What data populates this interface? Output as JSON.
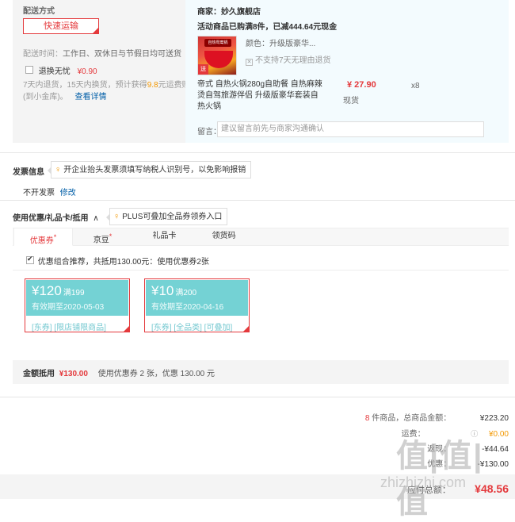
{
  "shipping": {
    "title": "配送方式",
    "method": "快速运输",
    "time_label": "配送时间：",
    "time_value": "工作日、双休日与节假日均可送货",
    "return_label": "退换无忧",
    "return_price": "¥0.90",
    "return_desc_1": "7天内退货，15天内换货，预计获得",
    "return_bonus": "9.8",
    "return_desc_2": "元运费赔付",
    "return_desc_3": "(到小金库)。",
    "details_link": "查看详情"
  },
  "shop": {
    "seller_label": "商家：",
    "seller_name": "妙久旗舰店",
    "promo_1": "活动商品已购满8件，已减444.64元现金",
    "color_label": "颜色：",
    "color_value": "升级版豪华...",
    "no_return_notice": "不支持7天无理由退货",
    "product_name": "帝式 自热火锅280g自助餐 自热麻辣烫自驾旅游伴侣 升级版豪华套装自热火锅",
    "price": "¥ 27.90",
    "quantity": "x8",
    "stock": "现货",
    "remark_label": "留言：",
    "remark_placeholder": "建议留言前先与商家沟通确认",
    "image_tag": "送",
    "image_pill": "自热鸳鸯锅"
  },
  "invoice": {
    "title": "发票信息",
    "tip": "开企业抬头发票须填写纳税人识别号，以免影响报销",
    "status": "不开发票",
    "edit_link": "修改"
  },
  "discount": {
    "title": "使用优惠/礼品卡/抵用",
    "chevron": "∧",
    "tip": "PLUS可叠加全品券领券入口",
    "tabs": [
      {
        "label": "优惠券",
        "mark": "*"
      },
      {
        "label": "京豆",
        "mark": "*"
      },
      {
        "label": "礼品卡",
        "mark": ""
      },
      {
        "label": "领货码",
        "mark": ""
      }
    ],
    "combo_text": "优惠组合推荐，共抵用130.00元：使用优惠券2张",
    "coupons": [
      {
        "amount": "¥120",
        "cond": "满199",
        "expire": "有效期至2020-05-03",
        "tags": "[东券] [限店铺限商品]"
      },
      {
        "amount": "¥10",
        "cond": "满200",
        "expire": "有效期至2020-04-16",
        "tags": "[东券] [全品类] [可叠加]"
      }
    ],
    "total_label": "金额抵用",
    "total_amount": "¥130.00",
    "total_desc": "使用优惠券 2 张，优惠 130.00 元"
  },
  "summary": {
    "count": "8",
    "count_text": "件商品，总商品金额：",
    "goods_total": "¥223.20",
    "shipping_label": "运费：",
    "shipping_fee": "¥0.00",
    "row3_label": "返现：",
    "row3_value": "-¥44.64",
    "row4_label": "优惠：",
    "row4_value": "-¥130.00",
    "payable_label": "应付总额：",
    "payable_value": "¥48.56"
  },
  "watermark": {
    "logo": "值|值|值",
    "url": "zhizhizhi.com"
  }
}
